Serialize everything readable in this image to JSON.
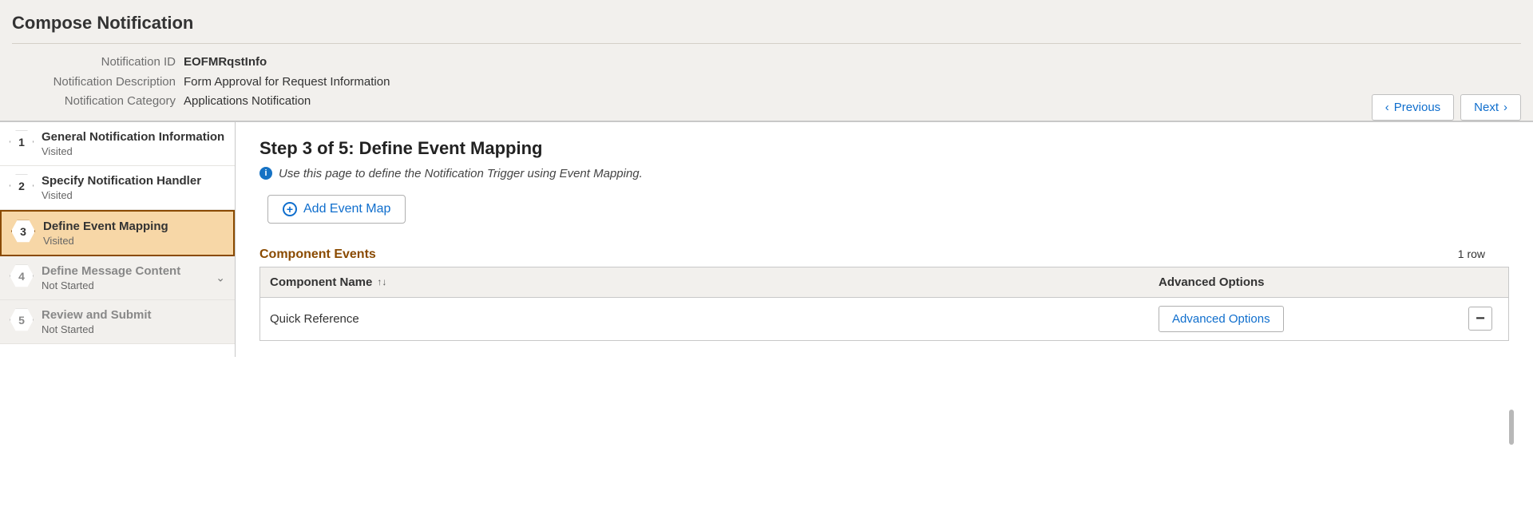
{
  "header": {
    "title": "Compose Notification",
    "fields": {
      "id_label": "Notification ID",
      "id_value": "EOFMRqstInfo",
      "desc_label": "Notification Description",
      "desc_value": "Form Approval for Request Information",
      "cat_label": "Notification Category",
      "cat_value": "Applications Notification"
    },
    "previous_label": "Previous",
    "next_label": "Next"
  },
  "sidebar": {
    "steps": [
      {
        "num": "1",
        "title": "General Notification Information",
        "status": "Visited"
      },
      {
        "num": "2",
        "title": "Specify Notification Handler",
        "status": "Visited"
      },
      {
        "num": "3",
        "title": "Define Event Mapping",
        "status": "Visited"
      },
      {
        "num": "4",
        "title": "Define Message Content",
        "status": "Not Started"
      },
      {
        "num": "5",
        "title": "Review and Submit",
        "status": "Not Started"
      }
    ]
  },
  "main": {
    "heading": "Step 3 of 5: Define Event Mapping",
    "hint": "Use this page to define the Notification Trigger using Event Mapping.",
    "add_label": "Add Event Map",
    "section_title": "Component Events",
    "row_count": "1 row",
    "columns": {
      "component": "Component Name",
      "advanced": "Advanced Options"
    },
    "rows": [
      {
        "component": "Quick Reference",
        "advanced_label": "Advanced Options"
      }
    ]
  }
}
